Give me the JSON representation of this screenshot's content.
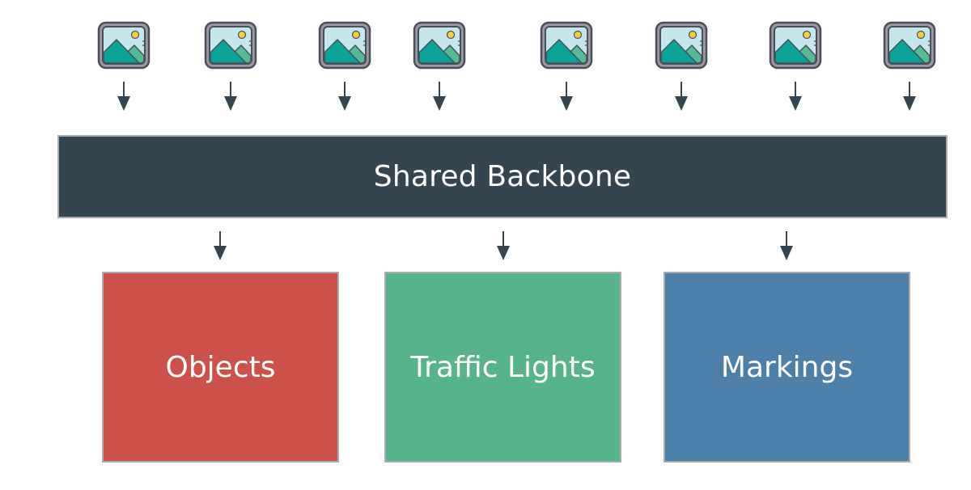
{
  "diagram": {
    "inputs": {
      "count": 8,
      "icon": "image-icon",
      "colors": {
        "frame": "#4a4f59",
        "frame_fill": "#9a99a6",
        "sky": "#c4e6ec",
        "sun": "#f4d03f",
        "mountain_main": "#0aa39a",
        "mountain_back": "#52bc97"
      }
    },
    "backbone": {
      "label": "Shared Backbone",
      "color": "#35454f"
    },
    "heads": [
      {
        "label": "Objects",
        "color": "#cb514a"
      },
      {
        "label": "Traffic Lights",
        "color": "#57b38a"
      },
      {
        "label": "Markings",
        "color": "#4c80a8"
      }
    ],
    "arrow_color": "#34454f"
  }
}
